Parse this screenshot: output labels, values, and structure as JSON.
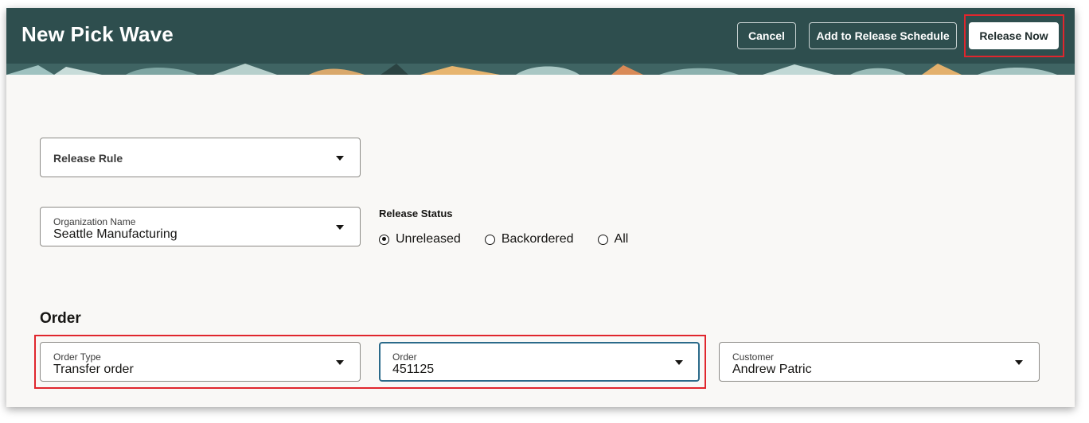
{
  "header": {
    "title": "New Pick Wave",
    "cancel_label": "Cancel",
    "add_schedule_label": "Add to Release Schedule",
    "release_now_label": "Release Now"
  },
  "release_rule": {
    "placeholder": "Release Rule"
  },
  "organization": {
    "label": "Organization Name",
    "value": "Seattle Manufacturing"
  },
  "release_status": {
    "label": "Release Status",
    "options": [
      "Unreleased",
      "Backordered",
      "All"
    ],
    "selected": "Unreleased"
  },
  "order_section": {
    "title": "Order",
    "order_type": {
      "label": "Order Type",
      "value": "Transfer order"
    },
    "order": {
      "label": "Order",
      "value": "451125"
    },
    "customer": {
      "label": "Customer",
      "value": "Andrew Patric"
    }
  },
  "colors": {
    "header_bg": "#2e4e4e",
    "highlight": "#e0262d",
    "focus_border": "#2b6a8a",
    "page_bg": "#f9f8f6"
  },
  "icons": {
    "dropdown": "caret-down-icon",
    "radio": "radio-icon"
  }
}
